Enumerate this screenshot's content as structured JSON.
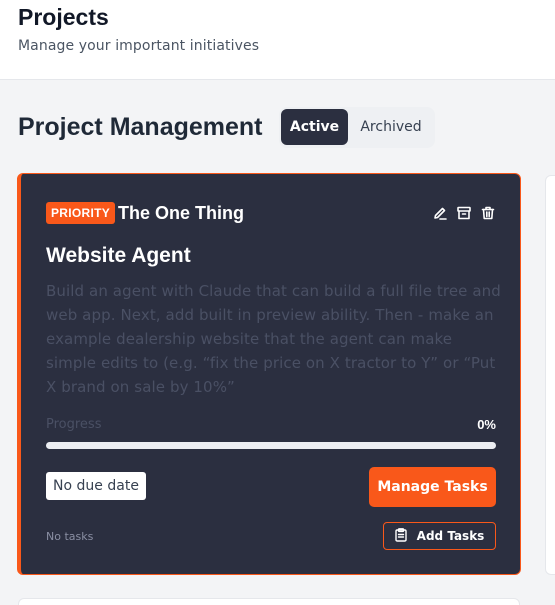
{
  "header": {
    "title": "Projects",
    "subtitle": "Manage your important initiatives"
  },
  "section": {
    "title": "Project Management",
    "tabs": [
      {
        "label": "Active",
        "active": true
      },
      {
        "label": "Archived",
        "active": false
      }
    ]
  },
  "colors": {
    "accent": "#f9581a",
    "card_bg": "#2b2f40",
    "page_bg": "#f3f4f6"
  },
  "project": {
    "badge": "PRIORITY",
    "tag": "The One Thing",
    "name": "Website Agent",
    "description": "Build an agent with Claude that can build a full file tree and web app. Next, add built in preview ability. Then - make an example dealership website that the agent can make simple edits to (e.g. “fix the price on X tractor to Y” or “Put X brand on sale by 10%”",
    "progress_label": "Progress",
    "progress_text": "0%",
    "progress_value": 0,
    "due_date": "No due date",
    "manage_label": "Manage Tasks",
    "tasks_text": "No tasks",
    "add_label": "Add Tasks",
    "action_icons": [
      "edit-icon",
      "archive-icon",
      "trash-icon"
    ]
  }
}
